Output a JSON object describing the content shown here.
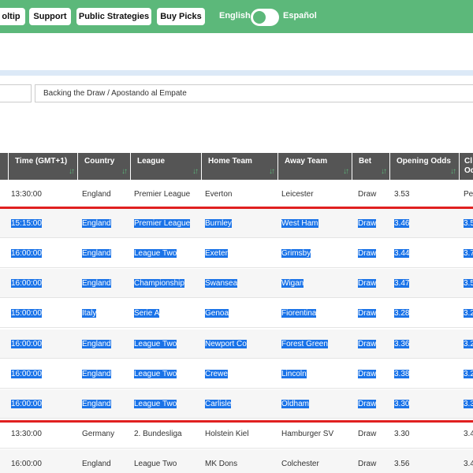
{
  "topbar": {
    "buttons": [
      "oltip",
      "Support",
      "Public Strategies",
      "Buy Picks"
    ],
    "lang_english": "English",
    "lang_espanol": "Español"
  },
  "filter": {
    "strategy_value": "Backing the Draw / Apostando al Empate"
  },
  "table": {
    "headers": [
      "",
      "Time (GMT+1)",
      "Country",
      "League",
      "Home Team",
      "Away Team",
      "Bet",
      "Opening Odds",
      "Cl Od"
    ],
    "rows": [
      {
        "time": "13:30:00",
        "country": "England",
        "league": "Premier League",
        "home": "Everton",
        "away": "Leicester",
        "bet": "Draw",
        "odds": "3.53",
        "extra": "Pe",
        "selected": false
      },
      {
        "time": "15:15:00",
        "country": "England",
        "league": "Premier League",
        "home": "Burnley",
        "away": "West Ham",
        "bet": "Draw",
        "odds": "3.46",
        "extra": "3.5",
        "selected": true
      },
      {
        "time": "16:00:00",
        "country": "England",
        "league": "League Two",
        "home": "Exeter",
        "away": "Grimsby",
        "bet": "Draw",
        "odds": "3.44",
        "extra": "3.7",
        "selected": true
      },
      {
        "time": "16:00:00",
        "country": "England",
        "league": "Championship",
        "home": "Swansea",
        "away": "Wigan",
        "bet": "Draw",
        "odds": "3.47",
        "extra": "3.5",
        "selected": true
      },
      {
        "time": "15:00:00",
        "country": "Italy",
        "league": "Serie A",
        "home": "Genoa",
        "away": "Fiorentina",
        "bet": "Draw",
        "odds": "3.28",
        "extra": "3.2",
        "selected": true
      },
      {
        "time": "16:00:00",
        "country": "England",
        "league": "League Two",
        "home": "Newport Co",
        "away": "Forest Green",
        "bet": "Draw",
        "odds": "3.36",
        "extra": "3.2",
        "selected": true
      },
      {
        "time": "16:00:00",
        "country": "England",
        "league": "League Two",
        "home": "Crewe",
        "away": "Lincoln",
        "bet": "Draw",
        "odds": "3.38",
        "extra": "3.2",
        "selected": true
      },
      {
        "time": "16:00:00",
        "country": "England",
        "league": "League Two",
        "home": "Carlisle",
        "away": "Oldham",
        "bet": "Draw",
        "odds": "3.30",
        "extra": "3.3",
        "selected": true
      },
      {
        "time": "13:30:00",
        "country": "Germany",
        "league": "2. Bundesliga",
        "home": "Holstein Kiel",
        "away": "Hamburger SV",
        "bet": "Draw",
        "odds": "3.30",
        "extra": "3.4",
        "selected": false
      },
      {
        "time": "16:00:00",
        "country": "England",
        "league": "League Two",
        "home": "MK Dons",
        "away": "Colchester",
        "bet": "Draw",
        "odds": "3.56",
        "extra": "3.4",
        "selected": false
      }
    ]
  },
  "colors": {
    "accent_green": "#5cb87a",
    "header_gray": "#555555",
    "selection_blue": "#1a73e8",
    "divider_red": "#e02020"
  },
  "icons": {
    "sort": "sort-arrows-icon"
  }
}
